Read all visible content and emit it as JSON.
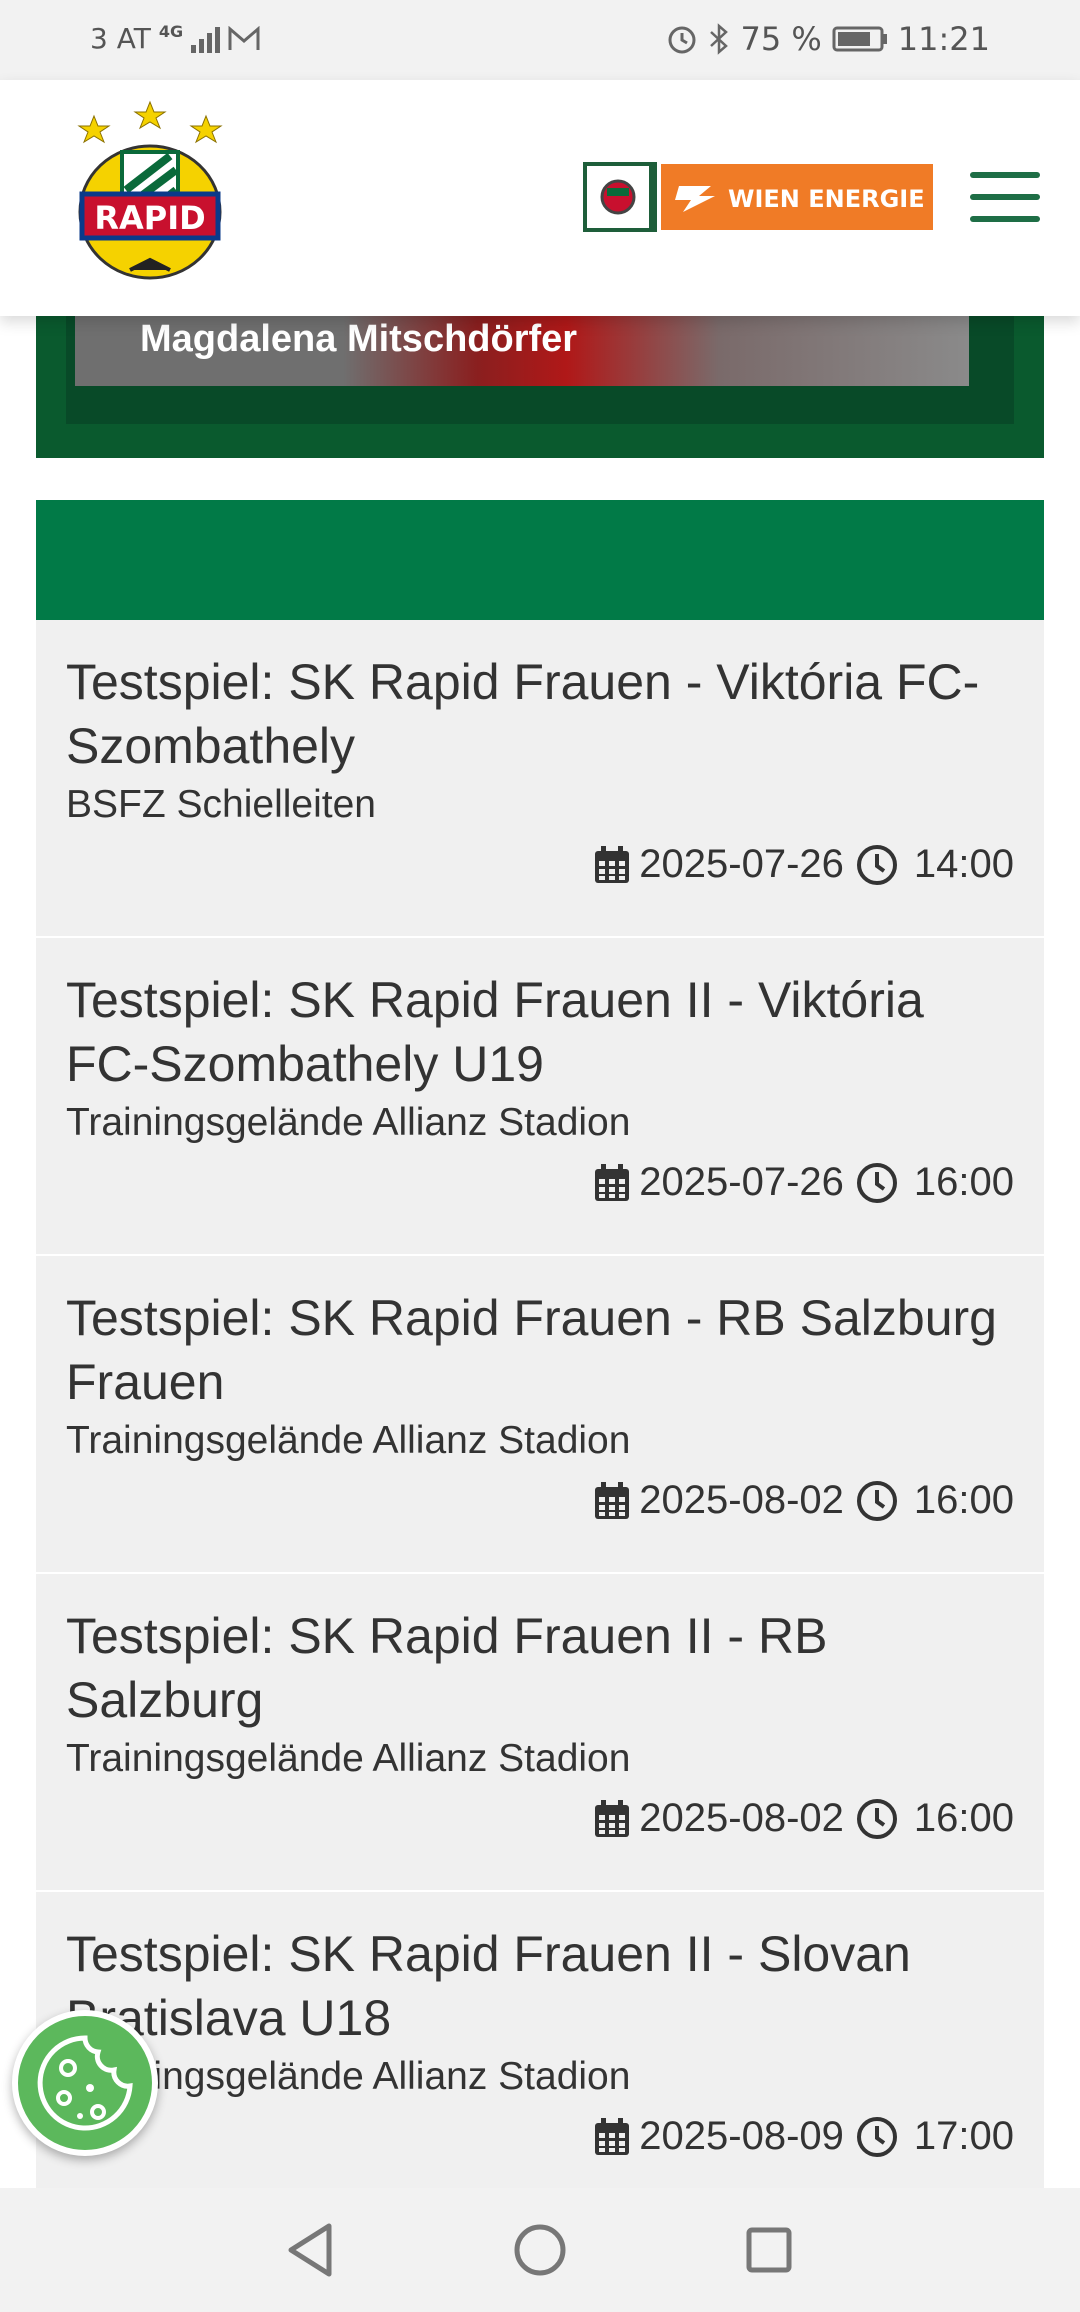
{
  "status_bar": {
    "carrier": "3 AT",
    "network": "4G",
    "battery": "75 %",
    "time": "11:21"
  },
  "header": {
    "logo_text": "RAPID",
    "sponsor_text": "WIEN ENERGIE"
  },
  "hero": {
    "player_name": "Magdalena Mitschdörfer"
  },
  "events": [
    {
      "title": "Testspiel: SK Rapid Frauen - Viktória FC-Szombathely",
      "venue": "BSFZ Schielleiten",
      "date": "2025-07-26",
      "time": "14:00"
    },
    {
      "title": "Testspiel: SK Rapid Frauen II - Viktória FC-Szombathely U19",
      "venue": "Trainingsgelände Allianz Stadion",
      "date": "2025-07-26",
      "time": "16:00"
    },
    {
      "title": "Testspiel: SK Rapid Frauen - RB Salzburg Frauen",
      "venue": "Trainingsgelände Allianz Stadion",
      "date": "2025-08-02",
      "time": "16:00"
    },
    {
      "title": "Testspiel: SK Rapid Frauen II - RB Salzburg",
      "venue": "Trainingsgelände Allianz Stadion",
      "date": "2025-08-02",
      "time": "16:00"
    },
    {
      "title": "Testspiel: SK Rapid Frauen II - Slovan Bratislava U18",
      "venue": "Trainingsgelände Allianz Stadion",
      "date": "2025-08-09",
      "time": "17:00"
    }
  ],
  "colors": {
    "rapid_green": "#017a47",
    "sponsor_orange": "#f07b26",
    "cookie_green": "#5cb85c"
  },
  "icons": {
    "calendar": "calendar-icon",
    "clock": "clock-icon",
    "menu": "hamburger-menu-icon",
    "cookie": "cookie-icon"
  }
}
